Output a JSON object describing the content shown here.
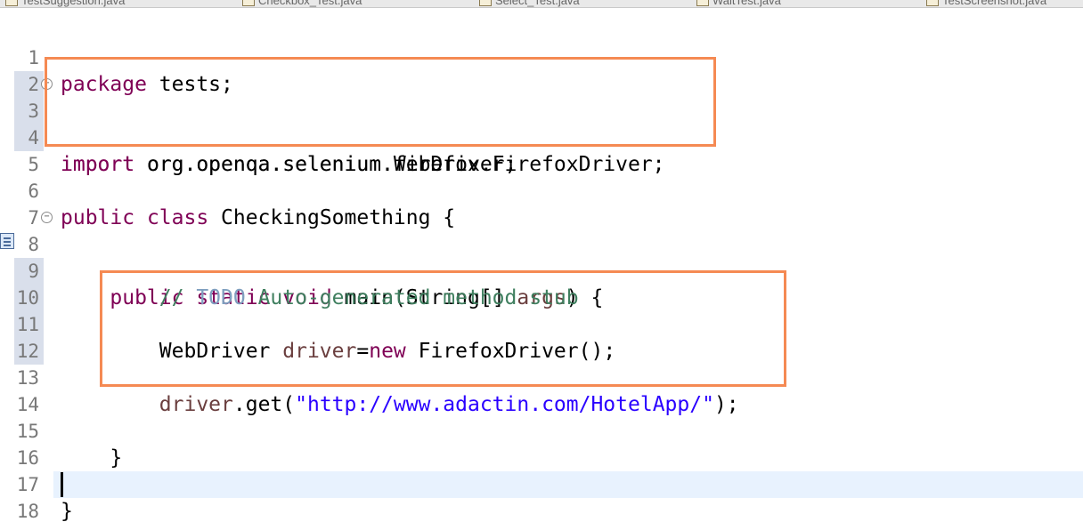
{
  "tabs": [
    {
      "label": "TestSuggestion.java"
    },
    {
      "label": "Checkbox_Test.java"
    },
    {
      "label": "Select_Test.java"
    },
    {
      "label": "WaitTest.java"
    },
    {
      "label": "TestScreenshot.java"
    }
  ],
  "editor": {
    "line_numbers": [
      "1",
      "2",
      "3",
      "4",
      "5",
      "6",
      "7",
      "8",
      "9",
      "10",
      "11",
      "12",
      "13",
      "14",
      "15",
      "16",
      "17",
      "18"
    ],
    "line1": {
      "keyword": "package",
      "rest": " tests;"
    },
    "line3": {
      "keyword": "import",
      "rest": " org.openqa.selenium.WebDriver;"
    },
    "line4": {
      "keyword": "import",
      "rest": " org.openqa.selenium.firefox.FirefoxDriver;"
    },
    "line6": {
      "kw1": "public",
      "kw2": "class",
      "rest": " CheckingSomething {"
    },
    "line8": {
      "indent": "    ",
      "kw1": "public",
      "kw2": "static",
      "kw3": "void",
      "rest_a": " main(String[] ",
      "param": "args",
      "rest_b": ") {"
    },
    "line9": {
      "indent": "        ",
      "comment_a": "// ",
      "todo": "TODO",
      "comment_b": " Auto-generated method stub"
    },
    "line11": {
      "indent": "        ",
      "type": "WebDriver ",
      "var": "driver",
      "eq": "=",
      "kw": "new",
      "rest": " FirefoxDriver();"
    },
    "line13": {
      "indent": "        ",
      "var": "driver",
      "call": ".get(",
      "string": "\"http://www.adactin.com/HotelApp/\"",
      "end": ");"
    },
    "line15": {
      "text": "    }"
    },
    "line17": {
      "text": "}"
    }
  },
  "colors": {
    "keyword": "#7f0055",
    "comment": "#3f7f5f",
    "todo": "#7f9fbf",
    "string": "#2a00ff",
    "variable": "#6a3e3e",
    "highlight_box": "#f58a53",
    "current_line": "#e8f2fe"
  },
  "icons": {
    "fold": "fold-collapse-icon",
    "task": "task-marker-icon",
    "tab": "java-file-icon"
  }
}
